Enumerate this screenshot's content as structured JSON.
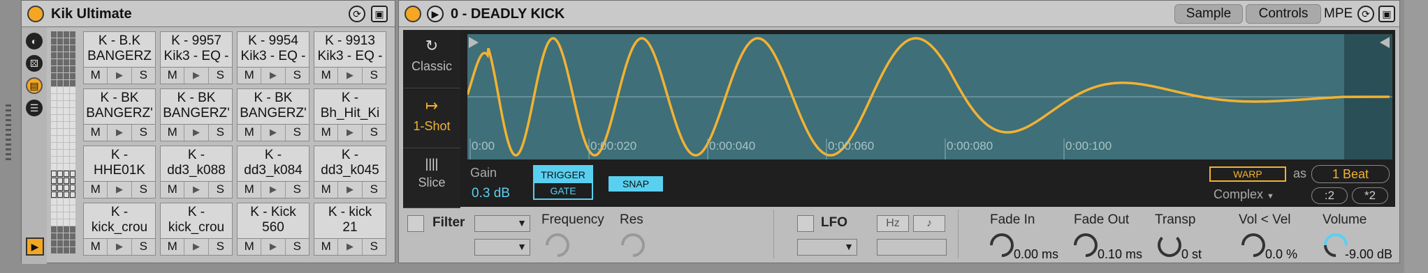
{
  "rack": {
    "title": "Kik Ultimate",
    "pads": [
      {
        "l1": "K - B.K",
        "l2": "BANGERZ"
      },
      {
        "l1": "K - 9957",
        "l2": "Kik3 - EQ -"
      },
      {
        "l1": "K - 9954",
        "l2": "Kik3 - EQ -"
      },
      {
        "l1": "K - 9913",
        "l2": "Kik3 - EQ -"
      },
      {
        "l1": "K - BK",
        "l2": "BANGERZ'"
      },
      {
        "l1": "K - BK",
        "l2": "BANGERZ'"
      },
      {
        "l1": "K - BK",
        "l2": "BANGERZ'"
      },
      {
        "l1": "K -",
        "l2": "Bh_Hit_Ki"
      },
      {
        "l1": "K -",
        "l2": "HHE01K"
      },
      {
        "l1": "K -",
        "l2": "dd3_k088"
      },
      {
        "l1": "K -",
        "l2": "dd3_k084"
      },
      {
        "l1": "K -",
        "l2": "dd3_k045"
      },
      {
        "l1": "K -",
        "l2": "kick_crou"
      },
      {
        "l1": "K -",
        "l2": "kick_crou"
      },
      {
        "l1": "K - Kick",
        "l2": "560"
      },
      {
        "l1": "K - kick",
        "l2": "21"
      }
    ],
    "mute_label": "M",
    "solo_label": "S"
  },
  "simpler": {
    "title": "0 - DEADLY KICK",
    "tabs": {
      "sample": "Sample",
      "controls": "Controls",
      "mpe": "MPE"
    },
    "modes": [
      {
        "icon": "↻",
        "label": "Classic"
      },
      {
        "icon": "↦",
        "label": "1-Shot"
      },
      {
        "icon": "||||",
        "label": "Slice"
      }
    ],
    "ruler": [
      "0:00",
      "0:00:020",
      "0:00:040",
      "0:00:060",
      "0:00:080",
      "0:00:100"
    ],
    "gain_label": "Gain",
    "gain_value": "0.3 dB",
    "trigger_label": "TRIGGER",
    "gate_label": "GATE",
    "snap_label": "SNAP",
    "warp_label": "WARP",
    "as_label": "as",
    "beat_value": "1 Beat",
    "warp_mode": "Complex",
    "div_label": ":2",
    "mul_label": "*2",
    "filter_label": "Filter",
    "frequency_label": "Frequency",
    "res_label": "Res",
    "lfo_label": "LFO",
    "hz_label": "Hz",
    "note_icon": "♪",
    "fade_in_label": "Fade In",
    "fade_in_value": "0.00 ms",
    "fade_out_label": "Fade Out",
    "fade_out_value": "0.10 ms",
    "transp_label": "Transp",
    "transp_value": "0 st",
    "vol_vel_label": "Vol < Vel",
    "vol_vel_value": "0.0 %",
    "volume_label": "Volume",
    "volume_value": "-9.00 dB"
  },
  "colors": {
    "accent": "#f5a623",
    "wave_bg": "#3f6f78",
    "wave": "#f2b233",
    "cyan": "#5ad0f0"
  }
}
